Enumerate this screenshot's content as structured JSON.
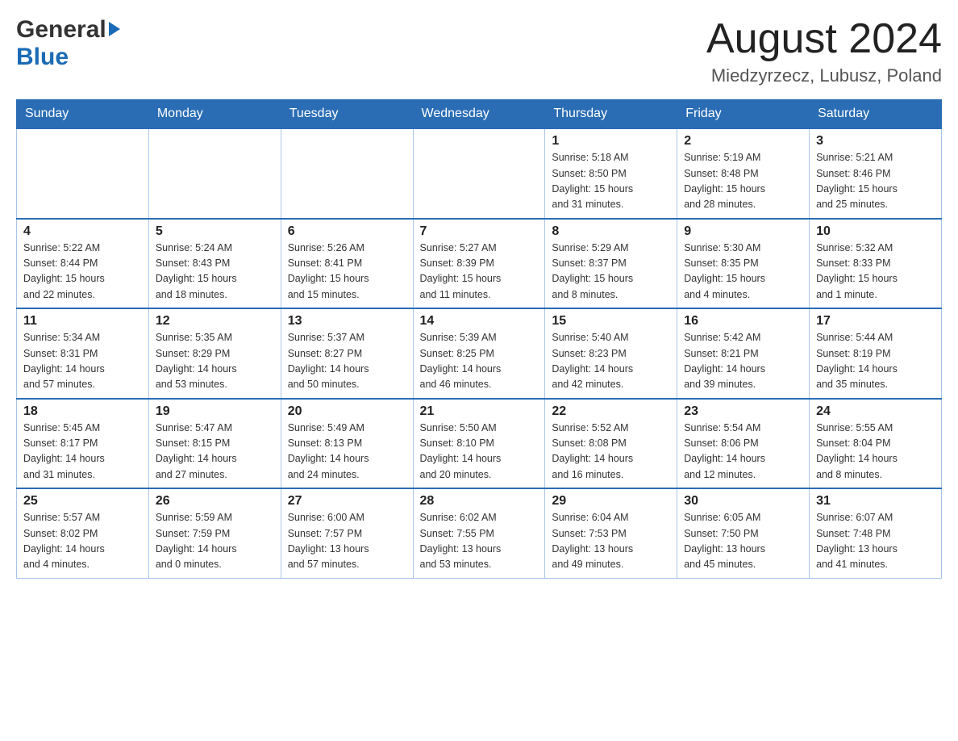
{
  "header": {
    "logo_line1": "General",
    "logo_line2": "Blue",
    "title": "August 2024",
    "subtitle": "Miedzyrzecz, Lubusz, Poland"
  },
  "days_of_week": [
    "Sunday",
    "Monday",
    "Tuesday",
    "Wednesday",
    "Thursday",
    "Friday",
    "Saturday"
  ],
  "weeks": [
    {
      "cells": [
        {
          "day": "",
          "info": ""
        },
        {
          "day": "",
          "info": ""
        },
        {
          "day": "",
          "info": ""
        },
        {
          "day": "",
          "info": ""
        },
        {
          "day": "1",
          "info": "Sunrise: 5:18 AM\nSunset: 8:50 PM\nDaylight: 15 hours\nand 31 minutes."
        },
        {
          "day": "2",
          "info": "Sunrise: 5:19 AM\nSunset: 8:48 PM\nDaylight: 15 hours\nand 28 minutes."
        },
        {
          "day": "3",
          "info": "Sunrise: 5:21 AM\nSunset: 8:46 PM\nDaylight: 15 hours\nand 25 minutes."
        }
      ]
    },
    {
      "cells": [
        {
          "day": "4",
          "info": "Sunrise: 5:22 AM\nSunset: 8:44 PM\nDaylight: 15 hours\nand 22 minutes."
        },
        {
          "day": "5",
          "info": "Sunrise: 5:24 AM\nSunset: 8:43 PM\nDaylight: 15 hours\nand 18 minutes."
        },
        {
          "day": "6",
          "info": "Sunrise: 5:26 AM\nSunset: 8:41 PM\nDaylight: 15 hours\nand 15 minutes."
        },
        {
          "day": "7",
          "info": "Sunrise: 5:27 AM\nSunset: 8:39 PM\nDaylight: 15 hours\nand 11 minutes."
        },
        {
          "day": "8",
          "info": "Sunrise: 5:29 AM\nSunset: 8:37 PM\nDaylight: 15 hours\nand 8 minutes."
        },
        {
          "day": "9",
          "info": "Sunrise: 5:30 AM\nSunset: 8:35 PM\nDaylight: 15 hours\nand 4 minutes."
        },
        {
          "day": "10",
          "info": "Sunrise: 5:32 AM\nSunset: 8:33 PM\nDaylight: 15 hours\nand 1 minute."
        }
      ]
    },
    {
      "cells": [
        {
          "day": "11",
          "info": "Sunrise: 5:34 AM\nSunset: 8:31 PM\nDaylight: 14 hours\nand 57 minutes."
        },
        {
          "day": "12",
          "info": "Sunrise: 5:35 AM\nSunset: 8:29 PM\nDaylight: 14 hours\nand 53 minutes."
        },
        {
          "day": "13",
          "info": "Sunrise: 5:37 AM\nSunset: 8:27 PM\nDaylight: 14 hours\nand 50 minutes."
        },
        {
          "day": "14",
          "info": "Sunrise: 5:39 AM\nSunset: 8:25 PM\nDaylight: 14 hours\nand 46 minutes."
        },
        {
          "day": "15",
          "info": "Sunrise: 5:40 AM\nSunset: 8:23 PM\nDaylight: 14 hours\nand 42 minutes."
        },
        {
          "day": "16",
          "info": "Sunrise: 5:42 AM\nSunset: 8:21 PM\nDaylight: 14 hours\nand 39 minutes."
        },
        {
          "day": "17",
          "info": "Sunrise: 5:44 AM\nSunset: 8:19 PM\nDaylight: 14 hours\nand 35 minutes."
        }
      ]
    },
    {
      "cells": [
        {
          "day": "18",
          "info": "Sunrise: 5:45 AM\nSunset: 8:17 PM\nDaylight: 14 hours\nand 31 minutes."
        },
        {
          "day": "19",
          "info": "Sunrise: 5:47 AM\nSunset: 8:15 PM\nDaylight: 14 hours\nand 27 minutes."
        },
        {
          "day": "20",
          "info": "Sunrise: 5:49 AM\nSunset: 8:13 PM\nDaylight: 14 hours\nand 24 minutes."
        },
        {
          "day": "21",
          "info": "Sunrise: 5:50 AM\nSunset: 8:10 PM\nDaylight: 14 hours\nand 20 minutes."
        },
        {
          "day": "22",
          "info": "Sunrise: 5:52 AM\nSunset: 8:08 PM\nDaylight: 14 hours\nand 16 minutes."
        },
        {
          "day": "23",
          "info": "Sunrise: 5:54 AM\nSunset: 8:06 PM\nDaylight: 14 hours\nand 12 minutes."
        },
        {
          "day": "24",
          "info": "Sunrise: 5:55 AM\nSunset: 8:04 PM\nDaylight: 14 hours\nand 8 minutes."
        }
      ]
    },
    {
      "cells": [
        {
          "day": "25",
          "info": "Sunrise: 5:57 AM\nSunset: 8:02 PM\nDaylight: 14 hours\nand 4 minutes."
        },
        {
          "day": "26",
          "info": "Sunrise: 5:59 AM\nSunset: 7:59 PM\nDaylight: 14 hours\nand 0 minutes."
        },
        {
          "day": "27",
          "info": "Sunrise: 6:00 AM\nSunset: 7:57 PM\nDaylight: 13 hours\nand 57 minutes."
        },
        {
          "day": "28",
          "info": "Sunrise: 6:02 AM\nSunset: 7:55 PM\nDaylight: 13 hours\nand 53 minutes."
        },
        {
          "day": "29",
          "info": "Sunrise: 6:04 AM\nSunset: 7:53 PM\nDaylight: 13 hours\nand 49 minutes."
        },
        {
          "day": "30",
          "info": "Sunrise: 6:05 AM\nSunset: 7:50 PM\nDaylight: 13 hours\nand 45 minutes."
        },
        {
          "day": "31",
          "info": "Sunrise: 6:07 AM\nSunset: 7:48 PM\nDaylight: 13 hours\nand 41 minutes."
        }
      ]
    }
  ]
}
